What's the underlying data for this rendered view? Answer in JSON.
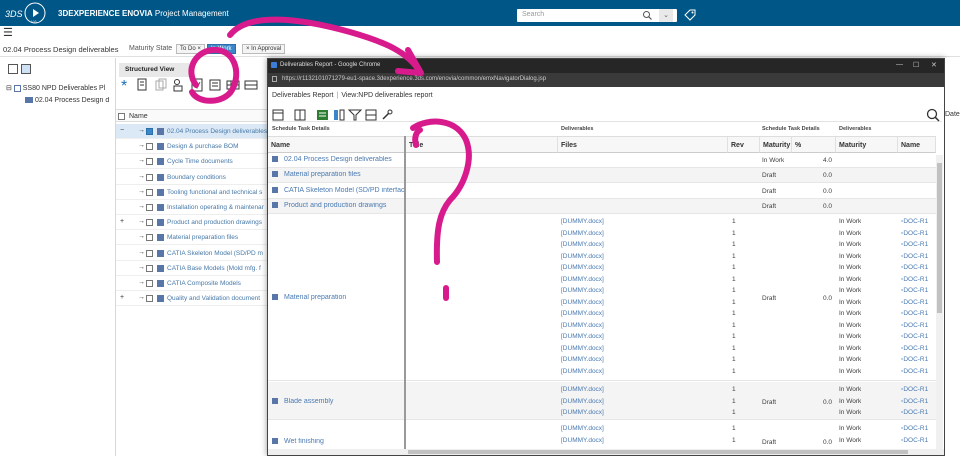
{
  "app": {
    "brand_3ds": "3DS",
    "brand_v6": "V,6",
    "title_bold": "3DEXPERIENCE ENOVIA",
    "title_rest": " Project Management",
    "search_placeholder": "Search",
    "accent_color": "#005686"
  },
  "filter": {
    "breadcrumb": "02.04 Process Design deliverables",
    "maturity_label": "Maturity State",
    "chips": [
      {
        "label": "To Do ×",
        "active": false
      },
      {
        "label": "In Work",
        "active": true
      },
      {
        "label": "× In Approval",
        "active": false
      }
    ]
  },
  "left_tree": {
    "root": "SS80 NPD Deliverables Pl",
    "child": "02.04 Process Design d"
  },
  "structured_view": {
    "tab_label": "Structured View",
    "name_header": "Name",
    "rows": [
      {
        "label": "02.04 Process Design deliverables",
        "expand": "−",
        "highlight": true,
        "checked": true
      },
      {
        "label": "Design & purchase BOM",
        "expand": "",
        "highlight": false
      },
      {
        "label": "Cycle Time documents",
        "expand": "",
        "highlight": false
      },
      {
        "label": "Boundary conditions",
        "expand": "",
        "highlight": false
      },
      {
        "label": "Tooling functional and technical s",
        "expand": "",
        "highlight": false
      },
      {
        "label": "Installation operating & maintenar",
        "expand": "",
        "highlight": false
      },
      {
        "label": "Product and production drawings",
        "expand": "+",
        "highlight": false
      },
      {
        "label": "Material preparation files",
        "expand": "",
        "highlight": false
      },
      {
        "label": "CATIA Skeleton Model (SD/PD m",
        "expand": "",
        "highlight": false
      },
      {
        "label": "CATIA Base Models (Mold mfg. f",
        "expand": "",
        "highlight": false
      },
      {
        "label": "CATIA Composite Models",
        "expand": "",
        "highlight": false
      },
      {
        "label": "Quality and Validation document",
        "expand": "+",
        "highlight": false
      }
    ]
  },
  "modal": {
    "window_title": "Deliverables Report - Google Chrome",
    "url": "https://r1132101071279-eu1-space.3dexperience.3ds.com/enovia/common/emxNavigatorDialog.jsp",
    "crumb_1": "Deliverables Report",
    "crumb_sep": "|",
    "crumb_2": "View:NPD deliverables report",
    "group_headers": {
      "schedule_task_details": "Schedule Task Details",
      "deliverables": "Deliverables",
      "schedule_task_details_2": "Schedule Task Details",
      "deliverables_2": "Deliverables"
    },
    "columns": [
      "Name",
      "Title",
      "Files",
      "Rev",
      "Maturity",
      "%",
      "Maturity",
      "Name"
    ],
    "top_rows": [
      {
        "name": "02.04 Process Design deliverables",
        "maturity": "In Work",
        "pct": "4.0"
      },
      {
        "name": "Material preparation files",
        "maturity": "Draft",
        "pct": "0.0"
      },
      {
        "name": "CATIA Skeleton Model (SD/PD interfac",
        "maturity": "Draft",
        "pct": "0.0"
      },
      {
        "name": "Product and production drawings",
        "maturity": "Draft",
        "pct": "0.0"
      }
    ],
    "group_material": {
      "name": "Material preparation",
      "maturity": "Draft",
      "pct": "0.0",
      "file": "[DUMMY.docx]",
      "rev": "1",
      "del_maturity": "In Work",
      "del_name": "DOC-R1",
      "count": 14
    },
    "group_blade": {
      "name": "Blade assembly",
      "maturity": "Draft",
      "pct": "0.0",
      "count": 3
    },
    "group_wet": {
      "name": "Wet finishing",
      "maturity": "Draft",
      "pct": "0.0",
      "count": 2
    }
  },
  "right_strip_label": "Date"
}
